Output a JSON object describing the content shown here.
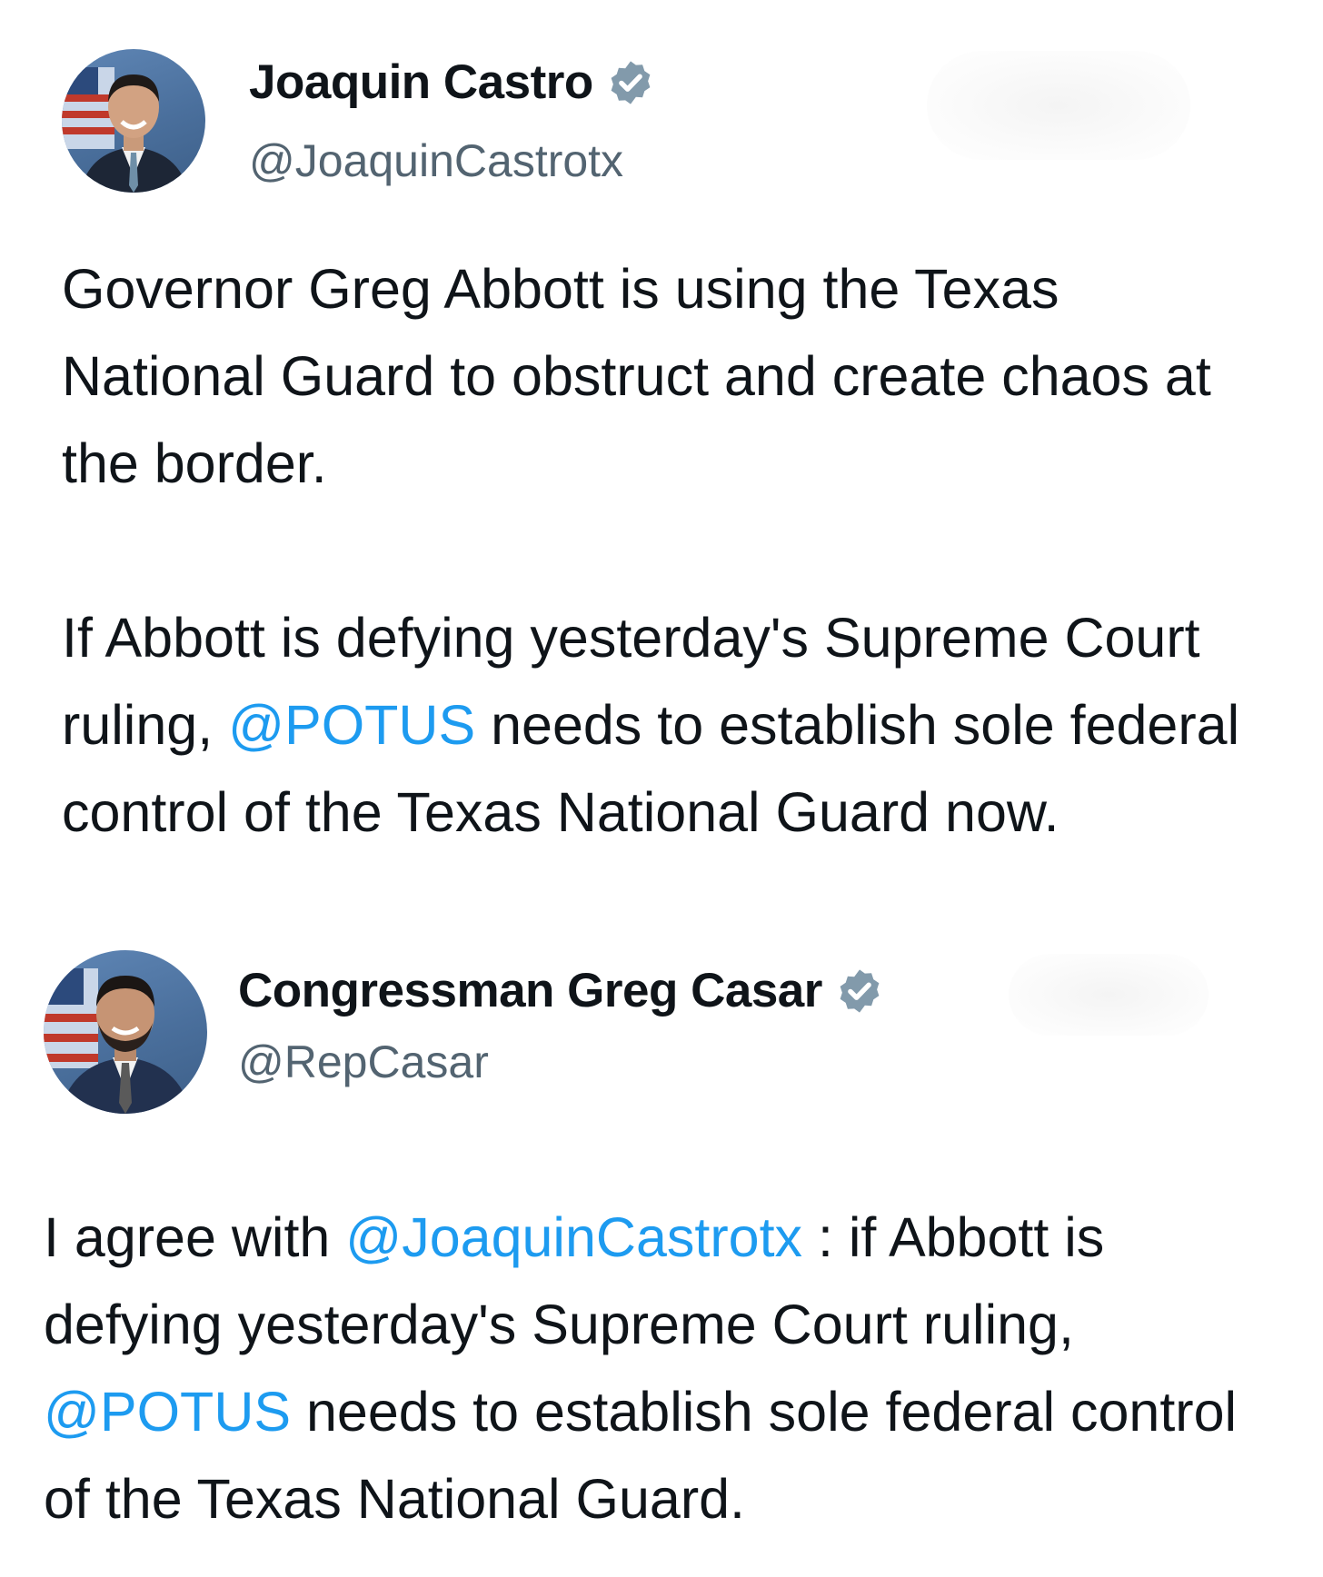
{
  "tweets": [
    {
      "display_name": "Joaquin Castro",
      "handle": "@JoaquinCastrotx",
      "verified_icon": "verified-badge-icon",
      "body": {
        "p1": "Governor Greg Abbott is using the Texas National Guard to obstruct and create chaos at the border.",
        "p2_before": "If Abbott is defying yesterday's Supreme Court ruling, ",
        "p2_mention": "@POTUS",
        "p2_after": " needs to establish sole federal control of the Texas National Guard now."
      }
    },
    {
      "display_name": "Congressman Greg Casar",
      "handle": "@RepCasar",
      "verified_icon": "verified-badge-icon",
      "body": {
        "before": "I agree with ",
        "mention1": "@JoaquinCastrotx",
        "middle": " : if Abbott is defying yesterday's Supreme Court ruling, ",
        "mention2": "@POTUS",
        "after": " needs to establish sole federal control of the Texas National Guard."
      }
    }
  ],
  "colors": {
    "text": "#0f1419",
    "handle": "#536471",
    "link": "#1d9bf0",
    "verified": "#829aab"
  }
}
